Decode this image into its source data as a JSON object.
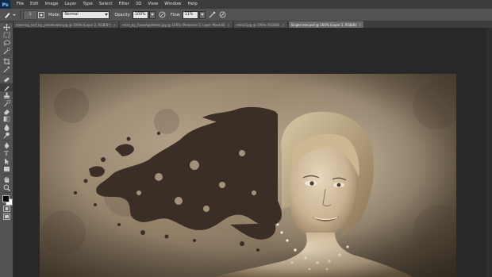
{
  "app": {
    "logo": "Ps"
  },
  "menu": [
    "File",
    "Edit",
    "Image",
    "Layer",
    "Type",
    "Select",
    "Filter",
    "3D",
    "View",
    "Window",
    "Help"
  ],
  "options": {
    "tool_icon": "brush-tool-icon",
    "brush_size": "1",
    "mode_label": "Mode:",
    "mode_value": "Normal",
    "opacity_label": "Opacity:",
    "opacity_value": "100%",
    "flow_label": "Flow:",
    "flow_value": "11%"
  },
  "tabs": [
    {
      "label": "morning_surf_by_pinkeknoke.jpg @ 100% (Layer 2, RGB/8*)",
      "active": false
    },
    {
      "label": "retro_by_FuwaAppletree.jpg @ 100% (Posterize 1, Layer Mask/8)",
      "active": false
    },
    {
      "label": "retro2.jpg @ 100% (RGB/8)",
      "active": false
    },
    {
      "label": "Single tree.psd @ 100% (Layer 2, RGB/8)",
      "active": true
    }
  ],
  "tab_close": "×",
  "toolbox": {
    "tools": [
      "move-tool-icon",
      "marquee-tool-icon",
      "lasso-tool-icon",
      "quick-select-tool-icon",
      "crop-tool-icon",
      "eyedropper-tool-icon",
      "healing-brush-tool-icon",
      "brush-tool-icon",
      "clone-stamp-tool-icon",
      "history-brush-tool-icon",
      "eraser-tool-icon",
      "gradient-tool-icon",
      "blur-tool-icon",
      "dodge-tool-icon",
      "pen-tool-icon",
      "type-tool-icon",
      "path-select-tool-icon",
      "shape-tool-icon",
      "hand-tool-icon",
      "zoom-tool-icon"
    ],
    "selected": "brush-tool-icon",
    "type_glyph": "T",
    "foreground": "#000000",
    "background": "#ffffff"
  },
  "colors": {
    "menubar": "#3c3c3c",
    "optionsbar": "#535353",
    "workspace": "#282828",
    "accent_logo": "#0f2d4a"
  }
}
